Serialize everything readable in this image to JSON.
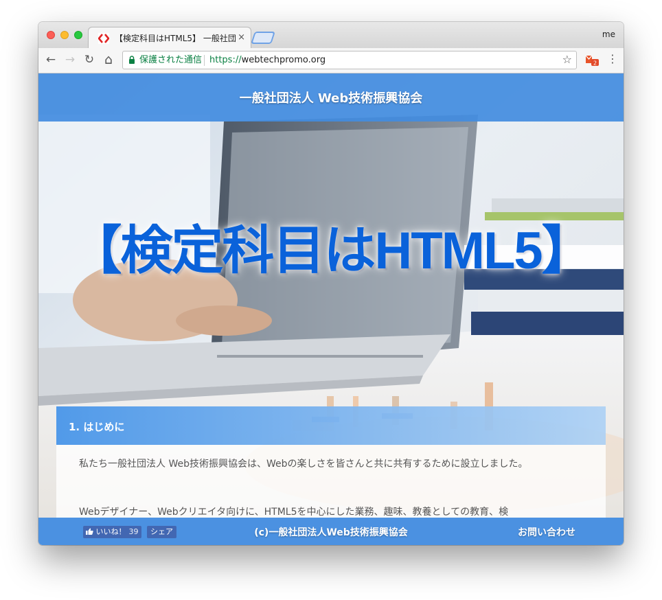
{
  "browser": {
    "tab": {
      "title": "【検定科目はHTML5】 一般社団法",
      "close": "×",
      "favicon": "red-diamond-brackets-icon"
    },
    "profile": "me",
    "nav": {
      "back": "←",
      "forward": "→",
      "reload": "↻",
      "home": "⌂"
    },
    "omnibox": {
      "security_text": "保護された通信",
      "url_scheme": "https://",
      "url_host": "webtechpromo.org",
      "bookmark": "☆"
    },
    "extension_badge": "2",
    "menu": "⋮"
  },
  "site": {
    "header_title": "一般社団法人 Web技術振興協会",
    "hero_title": "【検定科目はHTML5】",
    "section": {
      "heading": "1. はじめに",
      "paragraph_1": "私たち一般社団法人 Web技術振興協会は、Webの楽しさを皆さんと共に共有するために設立しました。",
      "paragraph_2": "Webデザイナー、Webクリエイタ向けに、HTML5を中心にした業務、趣味、教養としての教育、検"
    },
    "footer": {
      "like_label": "いいね！",
      "like_count": "39",
      "share_label": "シェア",
      "copyright": "(c)一般社団法人Web技術振興協会",
      "contact": "お問い合わせ"
    }
  },
  "colors": {
    "accent_blue": "#428ce0",
    "hero_title_blue": "#0a62da",
    "facebook_blue": "#4267b2",
    "secure_green": "#0b8043"
  }
}
